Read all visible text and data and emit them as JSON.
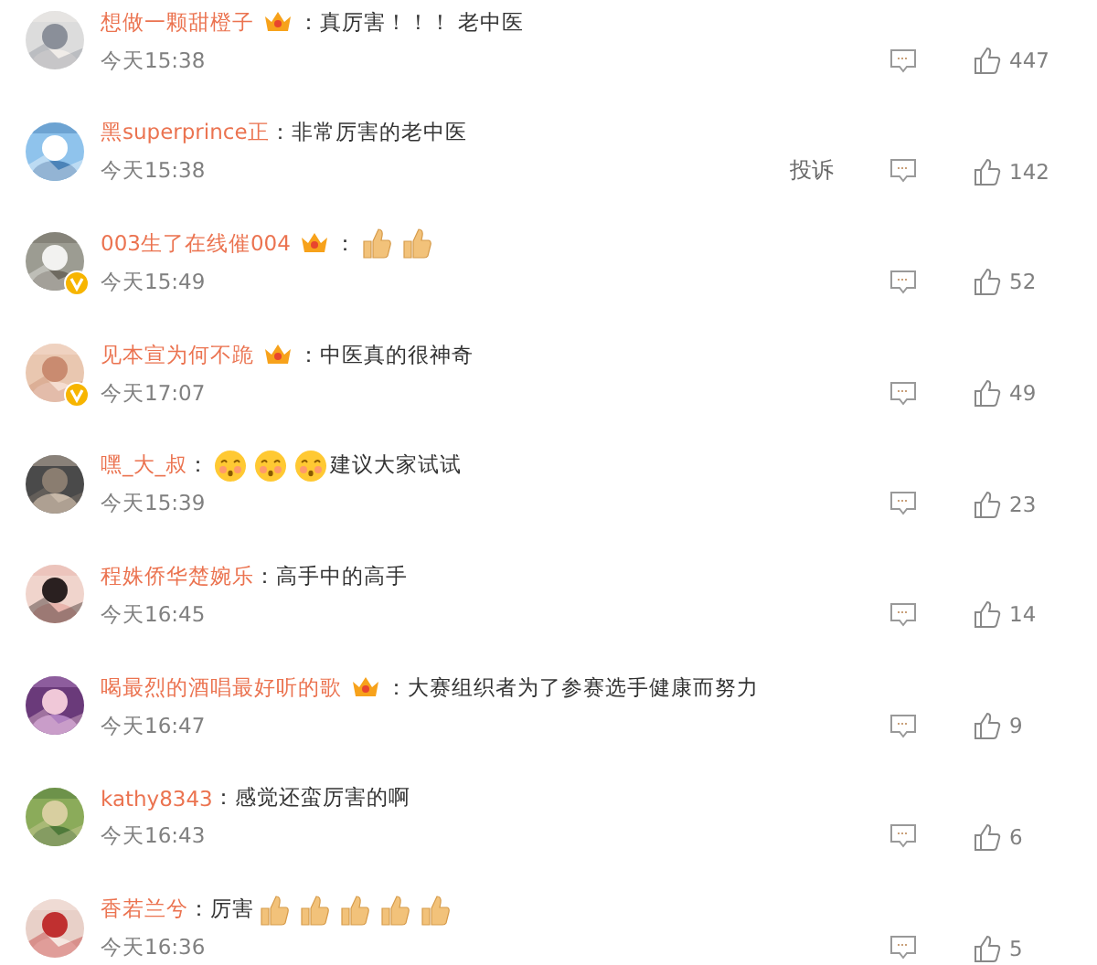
{
  "comments": [
    {
      "name": "想做一颗甜橙子",
      "crown": true,
      "verified": false,
      "content": [
        {
          "kind": "text",
          "text": "：真厉害！！！ 老中医"
        }
      ],
      "time": "今天15:38",
      "likes": "447"
    },
    {
      "name": "黑superprince正",
      "crown": false,
      "verified": false,
      "content": [
        {
          "kind": "text",
          "text": "：非常厉害的老中医"
        }
      ],
      "time": "今天15:38",
      "report": "投诉",
      "likes": "142"
    },
    {
      "name": "003生了在线催004",
      "crown": true,
      "verified": true,
      "content": [
        {
          "kind": "text",
          "text": "："
        },
        {
          "kind": "thumbs"
        },
        {
          "kind": "thumbs"
        }
      ],
      "time": "今天15:49",
      "likes": "52"
    },
    {
      "name": "见本宣为何不跪",
      "crown": true,
      "verified": true,
      "content": [
        {
          "kind": "text",
          "text": "：中医真的很神奇"
        }
      ],
      "time": "今天17:07",
      "likes": "49"
    },
    {
      "name": "嘿_大_叔",
      "crown": false,
      "verified": false,
      "content": [
        {
          "kind": "text",
          "text": "："
        },
        {
          "kind": "flushed"
        },
        {
          "kind": "flushed"
        },
        {
          "kind": "flushed"
        },
        {
          "kind": "text",
          "text": "建议大家试试"
        }
      ],
      "time": "今天15:39",
      "likes": "23"
    },
    {
      "name": "程姝侨华楚婉乐",
      "crown": false,
      "verified": false,
      "content": [
        {
          "kind": "text",
          "text": "：高手中的高手"
        }
      ],
      "time": "今天16:45",
      "likes": "14"
    },
    {
      "name": "喝最烈的酒唱最好听的歌",
      "crown": true,
      "verified": false,
      "content": [
        {
          "kind": "text",
          "text": "：大赛组织者为了参赛选手健康而努力"
        }
      ],
      "time": "今天16:47",
      "likes": "9"
    },
    {
      "name": "kathy8343",
      "crown": false,
      "verified": false,
      "content": [
        {
          "kind": "text",
          "text": "：感觉还蛮厉害的啊"
        }
      ],
      "time": "今天16:43",
      "likes": "6"
    },
    {
      "name": "香若兰兮",
      "crown": false,
      "verified": false,
      "content": [
        {
          "kind": "text",
          "text": "：厉害"
        },
        {
          "kind": "thumbs"
        },
        {
          "kind": "thumbs"
        },
        {
          "kind": "thumbs"
        },
        {
          "kind": "thumbs"
        },
        {
          "kind": "thumbs"
        }
      ],
      "time": "今天16:36",
      "likes": "5"
    }
  ]
}
